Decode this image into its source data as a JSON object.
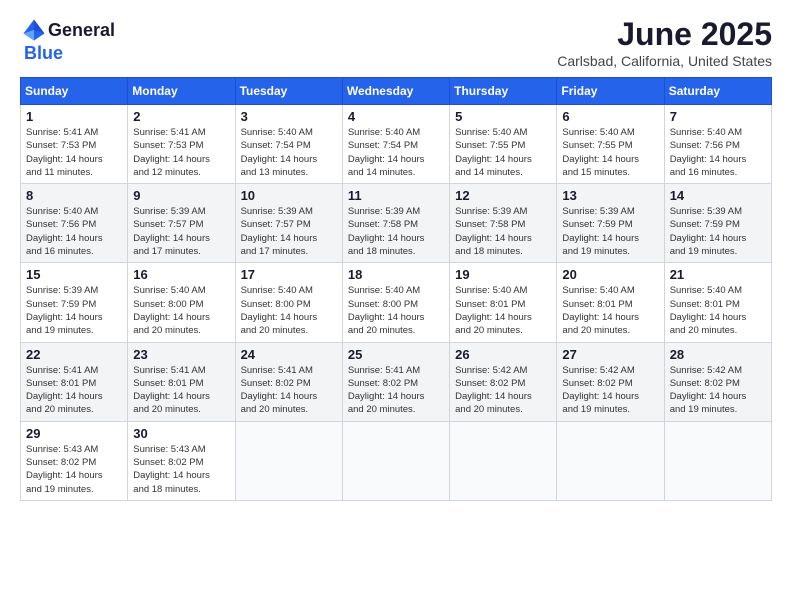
{
  "header": {
    "logo_general": "General",
    "logo_blue": "Blue",
    "month": "June 2025",
    "location": "Carlsbad, California, United States"
  },
  "weekdays": [
    "Sunday",
    "Monday",
    "Tuesday",
    "Wednesday",
    "Thursday",
    "Friday",
    "Saturday"
  ],
  "weeks": [
    [
      {
        "day": "1",
        "detail": "Sunrise: 5:41 AM\nSunset: 7:53 PM\nDaylight: 14 hours\nand 11 minutes."
      },
      {
        "day": "2",
        "detail": "Sunrise: 5:41 AM\nSunset: 7:53 PM\nDaylight: 14 hours\nand 12 minutes."
      },
      {
        "day": "3",
        "detail": "Sunrise: 5:40 AM\nSunset: 7:54 PM\nDaylight: 14 hours\nand 13 minutes."
      },
      {
        "day": "4",
        "detail": "Sunrise: 5:40 AM\nSunset: 7:54 PM\nDaylight: 14 hours\nand 14 minutes."
      },
      {
        "day": "5",
        "detail": "Sunrise: 5:40 AM\nSunset: 7:55 PM\nDaylight: 14 hours\nand 14 minutes."
      },
      {
        "day": "6",
        "detail": "Sunrise: 5:40 AM\nSunset: 7:55 PM\nDaylight: 14 hours\nand 15 minutes."
      },
      {
        "day": "7",
        "detail": "Sunrise: 5:40 AM\nSunset: 7:56 PM\nDaylight: 14 hours\nand 16 minutes."
      }
    ],
    [
      {
        "day": "8",
        "detail": "Sunrise: 5:40 AM\nSunset: 7:56 PM\nDaylight: 14 hours\nand 16 minutes."
      },
      {
        "day": "9",
        "detail": "Sunrise: 5:39 AM\nSunset: 7:57 PM\nDaylight: 14 hours\nand 17 minutes."
      },
      {
        "day": "10",
        "detail": "Sunrise: 5:39 AM\nSunset: 7:57 PM\nDaylight: 14 hours\nand 17 minutes."
      },
      {
        "day": "11",
        "detail": "Sunrise: 5:39 AM\nSunset: 7:58 PM\nDaylight: 14 hours\nand 18 minutes."
      },
      {
        "day": "12",
        "detail": "Sunrise: 5:39 AM\nSunset: 7:58 PM\nDaylight: 14 hours\nand 18 minutes."
      },
      {
        "day": "13",
        "detail": "Sunrise: 5:39 AM\nSunset: 7:59 PM\nDaylight: 14 hours\nand 19 minutes."
      },
      {
        "day": "14",
        "detail": "Sunrise: 5:39 AM\nSunset: 7:59 PM\nDaylight: 14 hours\nand 19 minutes."
      }
    ],
    [
      {
        "day": "15",
        "detail": "Sunrise: 5:39 AM\nSunset: 7:59 PM\nDaylight: 14 hours\nand 19 minutes."
      },
      {
        "day": "16",
        "detail": "Sunrise: 5:40 AM\nSunset: 8:00 PM\nDaylight: 14 hours\nand 20 minutes."
      },
      {
        "day": "17",
        "detail": "Sunrise: 5:40 AM\nSunset: 8:00 PM\nDaylight: 14 hours\nand 20 minutes."
      },
      {
        "day": "18",
        "detail": "Sunrise: 5:40 AM\nSunset: 8:00 PM\nDaylight: 14 hours\nand 20 minutes."
      },
      {
        "day": "19",
        "detail": "Sunrise: 5:40 AM\nSunset: 8:01 PM\nDaylight: 14 hours\nand 20 minutes."
      },
      {
        "day": "20",
        "detail": "Sunrise: 5:40 AM\nSunset: 8:01 PM\nDaylight: 14 hours\nand 20 minutes."
      },
      {
        "day": "21",
        "detail": "Sunrise: 5:40 AM\nSunset: 8:01 PM\nDaylight: 14 hours\nand 20 minutes."
      }
    ],
    [
      {
        "day": "22",
        "detail": "Sunrise: 5:41 AM\nSunset: 8:01 PM\nDaylight: 14 hours\nand 20 minutes."
      },
      {
        "day": "23",
        "detail": "Sunrise: 5:41 AM\nSunset: 8:01 PM\nDaylight: 14 hours\nand 20 minutes."
      },
      {
        "day": "24",
        "detail": "Sunrise: 5:41 AM\nSunset: 8:02 PM\nDaylight: 14 hours\nand 20 minutes."
      },
      {
        "day": "25",
        "detail": "Sunrise: 5:41 AM\nSunset: 8:02 PM\nDaylight: 14 hours\nand 20 minutes."
      },
      {
        "day": "26",
        "detail": "Sunrise: 5:42 AM\nSunset: 8:02 PM\nDaylight: 14 hours\nand 20 minutes."
      },
      {
        "day": "27",
        "detail": "Sunrise: 5:42 AM\nSunset: 8:02 PM\nDaylight: 14 hours\nand 19 minutes."
      },
      {
        "day": "28",
        "detail": "Sunrise: 5:42 AM\nSunset: 8:02 PM\nDaylight: 14 hours\nand 19 minutes."
      }
    ],
    [
      {
        "day": "29",
        "detail": "Sunrise: 5:43 AM\nSunset: 8:02 PM\nDaylight: 14 hours\nand 19 minutes."
      },
      {
        "day": "30",
        "detail": "Sunrise: 5:43 AM\nSunset: 8:02 PM\nDaylight: 14 hours\nand 18 minutes."
      },
      {
        "day": "",
        "detail": ""
      },
      {
        "day": "",
        "detail": ""
      },
      {
        "day": "",
        "detail": ""
      },
      {
        "day": "",
        "detail": ""
      },
      {
        "day": "",
        "detail": ""
      }
    ]
  ]
}
